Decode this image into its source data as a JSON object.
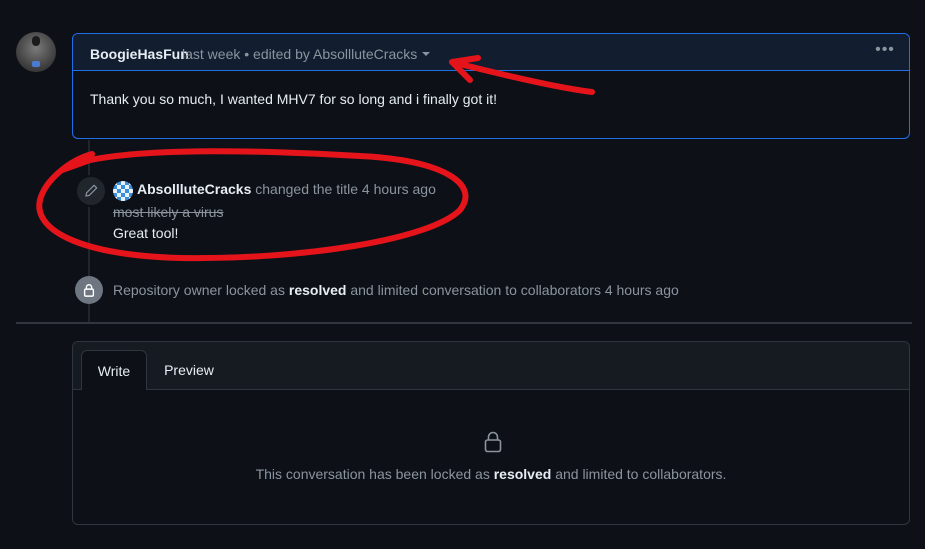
{
  "comment": {
    "author": "BoogieHasFun",
    "meta": "last week • edited by AbsollluteCracks",
    "menu_label": "•••",
    "body": "Thank you so much, I wanted MHV7 for so long and i finally got it!"
  },
  "events": {
    "title_change": {
      "actor": "AbsollluteCracks",
      "action": "changed the title",
      "time": "4 hours ago",
      "old_title": "most likely a virus",
      "new_title": "Great tool!"
    },
    "lock": {
      "prefix": "Repository owner locked as",
      "reason": "resolved",
      "suffix": "and limited conversation to collaborators 4 hours ago"
    }
  },
  "editor": {
    "tabs": [
      "Write",
      "Preview"
    ],
    "locked_prefix": "This conversation has been locked as",
    "locked_reason": "resolved",
    "locked_suffix": "and limited to collaborators."
  },
  "colors": {
    "background": "#0d1117",
    "comment_border": "#1f6feb",
    "annotation": "#e5141b"
  },
  "icons": [
    "pencil-icon",
    "lock-icon",
    "kebab-menu-icon",
    "dropdown-caret-icon"
  ]
}
